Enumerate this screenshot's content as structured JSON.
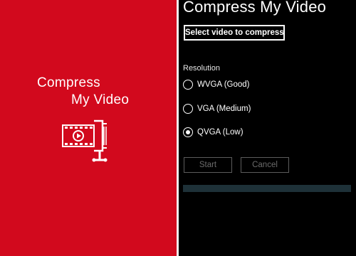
{
  "splash": {
    "title_line1": "Compress",
    "title_line2": "My Video",
    "logo_icon": "film-clamp-icon",
    "background": "#d2091d"
  },
  "app": {
    "title": "Compress My Video",
    "select_button_label": "Select video to compress",
    "resolution_label": "Resolution",
    "options": [
      {
        "label": "WVGA (Good)",
        "selected": false
      },
      {
        "label": "VGA (Medium)",
        "selected": false
      },
      {
        "label": "QVGA (Low)",
        "selected": true
      }
    ],
    "start_label": "Start",
    "cancel_label": "Cancel",
    "progress": 0
  }
}
